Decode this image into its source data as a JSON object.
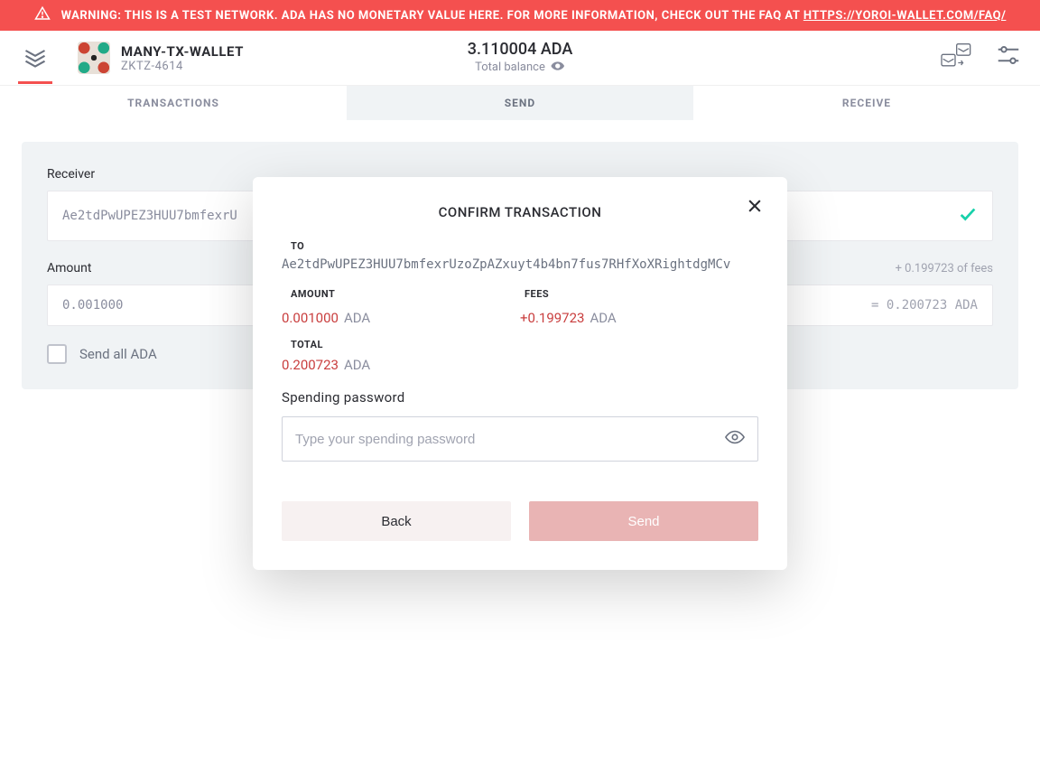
{
  "warning": {
    "text_prefix": "WARNING: THIS IS A TEST NETWORK. ADA HAS NO MONETARY VALUE HERE. FOR MORE INFORMATION, CHECK OUT THE FAQ AT ",
    "link": "HTTPS://YOROI-WALLET.COM/FAQ/"
  },
  "header": {
    "wallet_name": "MANY-TX-WALLET",
    "wallet_id": "ZKTZ-4614",
    "balance_amount": "3.110004 ADA",
    "balance_label": "Total balance"
  },
  "tabs": {
    "transactions": "TRANSACTIONS",
    "send": "SEND",
    "receive": "RECEIVE"
  },
  "send_form": {
    "receiver_label": "Receiver",
    "receiver_value": "Ae2tdPwUPEZ3HUU7bmfexrU",
    "amount_label": "Amount",
    "fees_hint": "+ 0.199723 of fees",
    "amount_value": "0.001000",
    "amount_total": "= 0.200723 ADA",
    "send_all_label": "Send all ADA"
  },
  "modal": {
    "title": "CONFIRM TRANSACTION",
    "to_label": "TO",
    "to_value": "Ae2tdPwUPEZ3HUU7bmfexrUzoZpAZxuyt4b4bn7fus7RHfXoXRightdgMCv",
    "amount_label": "AMOUNT",
    "amount_value": "0.001000",
    "amount_currency": "ADA",
    "fees_label": "FEES",
    "fees_value": "+0.199723",
    "fees_currency": "ADA",
    "total_label": "TOTAL",
    "total_value": "0.200723",
    "total_currency": "ADA",
    "password_label": "Spending password",
    "password_placeholder": "Type your spending password",
    "back_label": "Back",
    "send_label": "Send"
  }
}
